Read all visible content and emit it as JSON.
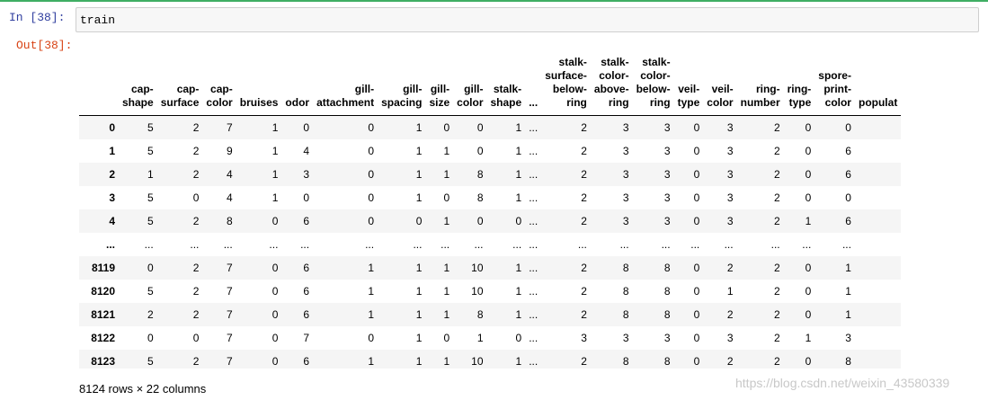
{
  "cell_in": {
    "prompt": "In  [38]:",
    "code": "train"
  },
  "cell_out": {
    "prompt": "Out[38]:"
  },
  "table": {
    "columns": [
      [
        "cap-",
        "shape"
      ],
      [
        "cap-",
        "surface"
      ],
      [
        "cap-",
        "color"
      ],
      [
        "bruises"
      ],
      [
        "odor"
      ],
      [
        "gill-",
        "attachment"
      ],
      [
        "gill-",
        "spacing"
      ],
      [
        "gill-",
        "size"
      ],
      [
        "gill-",
        "color"
      ],
      [
        "stalk-",
        "shape"
      ],
      [
        "..."
      ],
      [
        "stalk-",
        "surface-",
        "below-",
        "ring"
      ],
      [
        "stalk-",
        "color-",
        "above-",
        "ring"
      ],
      [
        "stalk-",
        "color-",
        "below-",
        "ring"
      ],
      [
        "veil-",
        "type"
      ],
      [
        "veil-",
        "color"
      ],
      [
        "ring-",
        "number"
      ],
      [
        "ring-",
        "type"
      ],
      [
        "spore-",
        "print-",
        "color"
      ],
      [
        "populat"
      ]
    ],
    "rows": [
      {
        "index": "0",
        "values": [
          "5",
          "2",
          "7",
          "1",
          "0",
          "0",
          "1",
          "0",
          "0",
          "1",
          "...",
          "2",
          "3",
          "3",
          "0",
          "3",
          "2",
          "0",
          "0",
          ""
        ]
      },
      {
        "index": "1",
        "values": [
          "5",
          "2",
          "9",
          "1",
          "4",
          "0",
          "1",
          "1",
          "0",
          "1",
          "...",
          "2",
          "3",
          "3",
          "0",
          "3",
          "2",
          "0",
          "6",
          ""
        ]
      },
      {
        "index": "2",
        "values": [
          "1",
          "2",
          "4",
          "1",
          "3",
          "0",
          "1",
          "1",
          "8",
          "1",
          "...",
          "2",
          "3",
          "3",
          "0",
          "3",
          "2",
          "0",
          "6",
          ""
        ]
      },
      {
        "index": "3",
        "values": [
          "5",
          "0",
          "4",
          "1",
          "0",
          "0",
          "1",
          "0",
          "8",
          "1",
          "...",
          "2",
          "3",
          "3",
          "0",
          "3",
          "2",
          "0",
          "0",
          ""
        ]
      },
      {
        "index": "4",
        "values": [
          "5",
          "2",
          "8",
          "0",
          "6",
          "0",
          "0",
          "1",
          "0",
          "0",
          "...",
          "2",
          "3",
          "3",
          "0",
          "3",
          "2",
          "1",
          "6",
          ""
        ]
      },
      {
        "index": "...",
        "values": [
          "...",
          "...",
          "...",
          "...",
          "...",
          "...",
          "...",
          "...",
          "...",
          "...",
          "...",
          "...",
          "...",
          "...",
          "...",
          "...",
          "...",
          "...",
          "...",
          ""
        ]
      },
      {
        "index": "8119",
        "values": [
          "0",
          "2",
          "7",
          "0",
          "6",
          "1",
          "1",
          "1",
          "10",
          "1",
          "...",
          "2",
          "8",
          "8",
          "0",
          "2",
          "2",
          "0",
          "1",
          ""
        ]
      },
      {
        "index": "8120",
        "values": [
          "5",
          "2",
          "7",
          "0",
          "6",
          "1",
          "1",
          "1",
          "10",
          "1",
          "...",
          "2",
          "8",
          "8",
          "0",
          "1",
          "2",
          "0",
          "1",
          ""
        ]
      },
      {
        "index": "8121",
        "values": [
          "2",
          "2",
          "7",
          "0",
          "6",
          "1",
          "1",
          "1",
          "8",
          "1",
          "...",
          "2",
          "8",
          "8",
          "0",
          "2",
          "2",
          "0",
          "1",
          ""
        ]
      },
      {
        "index": "8122",
        "values": [
          "0",
          "0",
          "7",
          "0",
          "7",
          "0",
          "1",
          "0",
          "1",
          "0",
          "...",
          "3",
          "3",
          "3",
          "0",
          "3",
          "2",
          "1",
          "3",
          ""
        ]
      },
      {
        "index": "8123",
        "values": [
          "5",
          "2",
          "7",
          "0",
          "6",
          "1",
          "1",
          "1",
          "10",
          "1",
          "...",
          "2",
          "8",
          "8",
          "0",
          "2",
          "2",
          "0",
          "8",
          ""
        ]
      }
    ]
  },
  "footer": "8124 rows × 22 columns",
  "watermark": "https://blog.csdn.net/weixin_43580339"
}
